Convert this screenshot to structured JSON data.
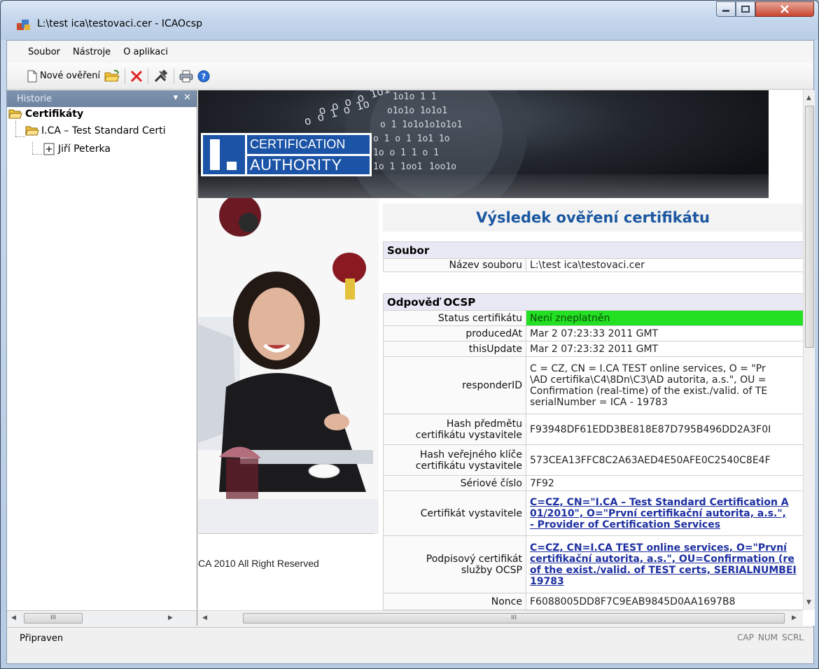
{
  "window": {
    "title": "L:\\test ica\\testovaci.cer - ICAOcsp"
  },
  "menu": {
    "items": [
      "Soubor",
      "Nástroje",
      "O aplikaci"
    ]
  },
  "toolbar": {
    "new_verification_label": "Nové ověření",
    "icons": [
      "new-document-icon",
      "open-folder-icon",
      "delete-icon",
      "tools-icon",
      "print-icon",
      "help-icon"
    ]
  },
  "sidebar": {
    "title": "Historie",
    "tree": {
      "root": "Certifikáty",
      "child": "I.CA – Test Standard Certi",
      "leaf": "Jiří Peterka"
    },
    "scroll_thumb_label": "III"
  },
  "banner": {
    "logo_line1": "CERTIFICATION",
    "logo_line2": "AUTHORITY",
    "binary_rows": [
      "o o o  o 1o1",
      "o o   1 o 1o",
      "1o1o  1 1",
      "o1o1o 1o1o1",
      "o 1  1o1o1o1o1o1",
      "o 1 o 1   1o1 1o",
      "1o  o 1  1 o 1",
      "1o 1 1oo1",
      "1oo1o"
    ]
  },
  "copyright": "CA 2010 All Right Reserved",
  "result": {
    "title": "Výsledek ověření certifikátu",
    "file_section": "Soubor",
    "file_name_label": "Název souboru",
    "file_name_value": "L:\\test ica\\testovaci.cer",
    "ocsp_section": "Odpověď OCSP",
    "rows": {
      "status_label": "Status certifikátu",
      "status_value": "Není zneplatněn",
      "produced_label": "producedAt",
      "produced_value": "Mar 2 07:23:33 2011 GMT",
      "this_update_label": "thisUpdate",
      "this_update_value": "Mar 2 07:23:32 2011 GMT",
      "responder_label": "responderID",
      "responder_lines": [
        "C = CZ, CN = I.CA TEST online services, O = \"Pr",
        "\\AD certifika\\C4\\8Dn\\C3\\AD autorita, a.s.\", OU =",
        "Confirmation (real-time) of the exist./valid. of TE",
        "serialNumber = ICA - 19783"
      ],
      "hash_subject_label_1": "Hash předmětu",
      "hash_subject_label_2": "certifikátu vystavitele",
      "hash_subject_value": "F93948DF61EDD3BE818E87D795B496DD2A3F0I",
      "hash_key_label_1": "Hash veřejného klíče",
      "hash_key_label_2": "certifikátu vystavitele",
      "hash_key_value": "573CEA13FFC8C2A63AED4E50AFE0C2540C8E4F",
      "serial_label": "Sériové číslo",
      "serial_value": "7F92",
      "issuer_label": "Certifikát vystavitele",
      "issuer_lines": [
        "C=CZ, CN=\"I.CA – Test Standard Certification A",
        "01/2010\", O=\"První certifikační autorita, a.s.\",",
        "- Provider of Certification Services"
      ],
      "signing_label_1": "Podpisový certifikát",
      "signing_label_2": "služby OCSP",
      "signing_lines": [
        "C=CZ, CN=I.CA TEST online services, O=\"První",
        "certifikační autorita, a.s.\", OU=Confirmation (re",
        "of the exist./valid. of TEST certs, SERIALNUMBEI",
        "19783"
      ],
      "nonce_label": "Nonce",
      "nonce_value": "F6088005DD8F7C9EAB9845D0AA1697B8"
    }
  },
  "content_hscroll_label": "III",
  "status": {
    "text": "Připraven",
    "indicators": [
      "CAP",
      "NUM",
      "SCRL"
    ]
  },
  "colors": {
    "status_ok": "#23e023",
    "title_blue": "#1a57a0",
    "link_blue": "#1d2fa0",
    "logo_blue": "#1b53a6"
  }
}
